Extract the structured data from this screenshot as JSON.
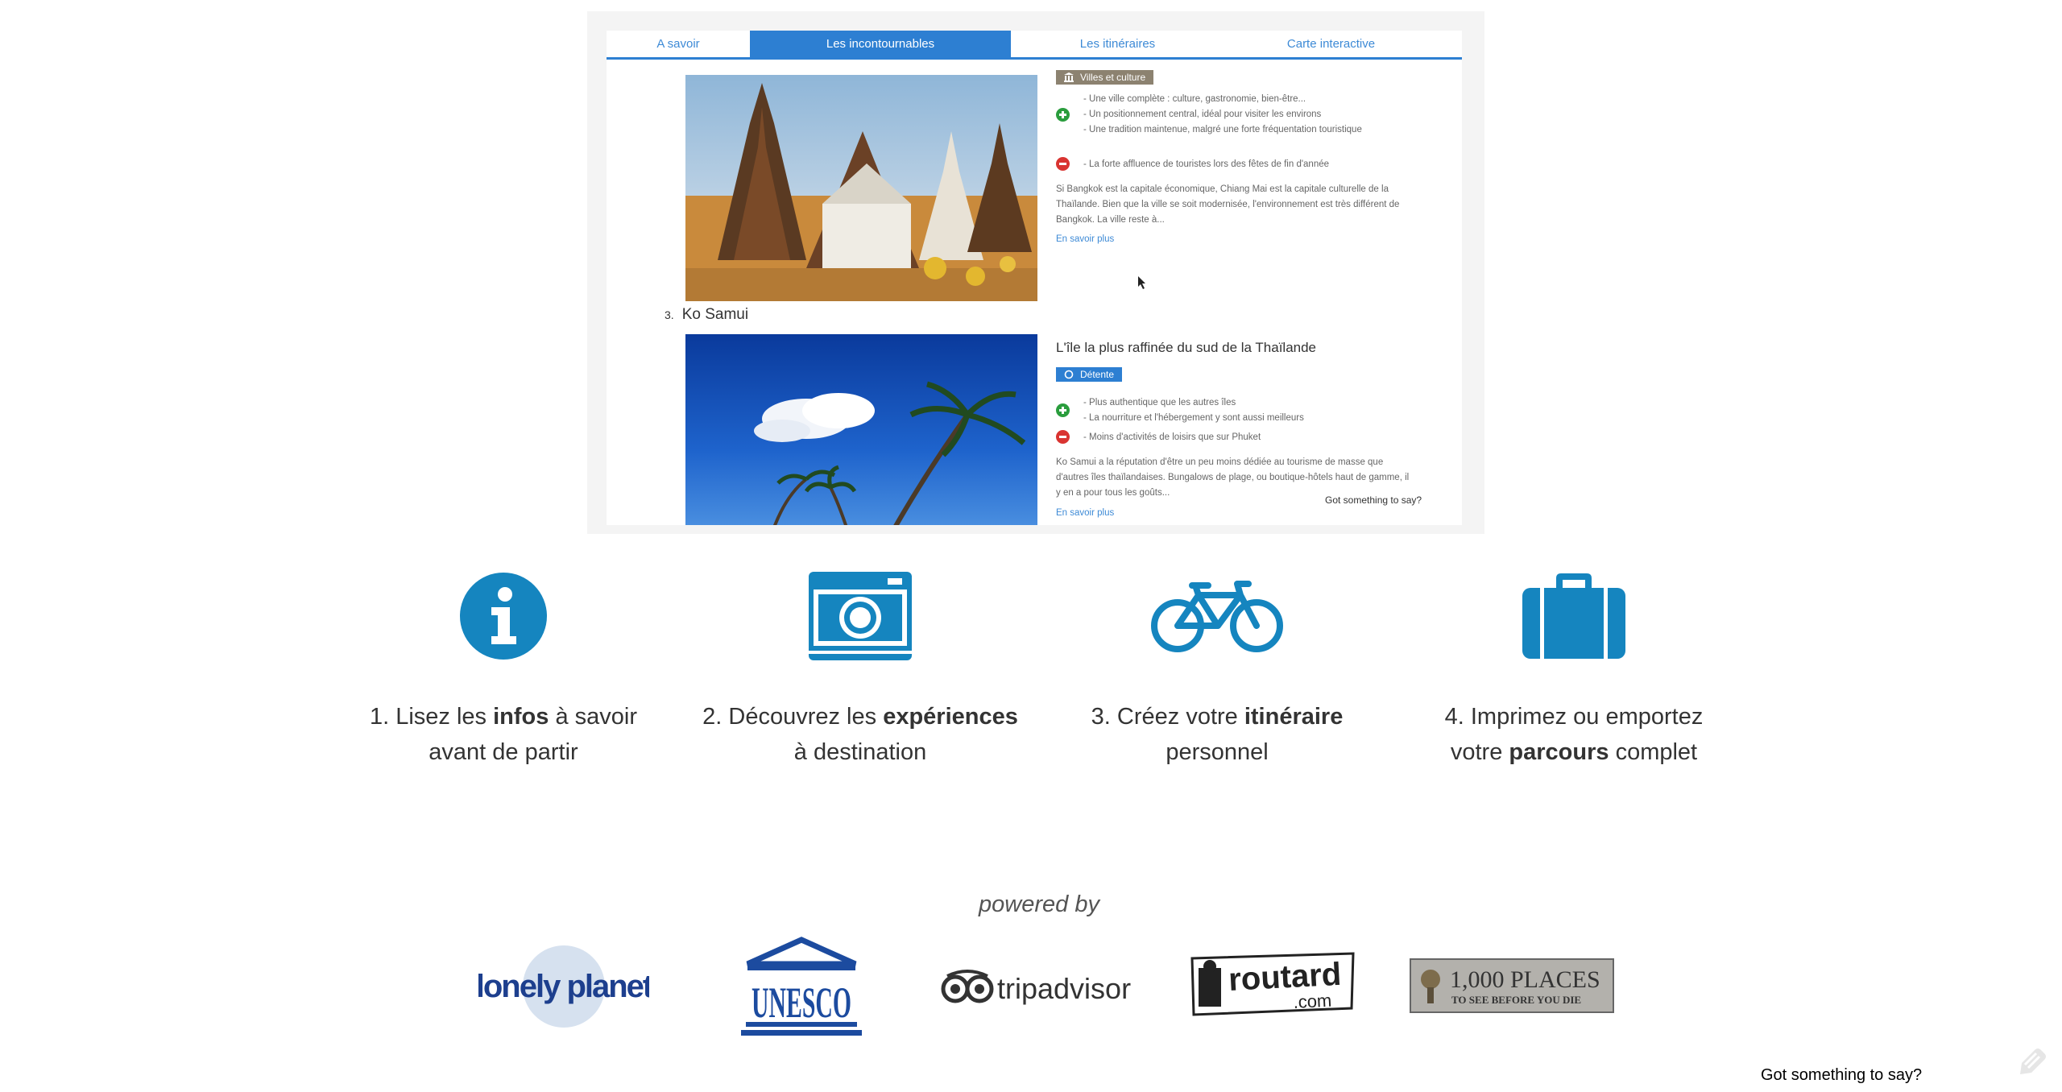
{
  "preview": {
    "tabs": [
      {
        "label": "A savoir",
        "active": false
      },
      {
        "label": "Les incontournables",
        "active": true
      },
      {
        "label": "Les itinéraires",
        "active": false
      },
      {
        "label": "Carte interactive",
        "active": false
      }
    ],
    "item2": {
      "tag": "Villes et culture",
      "pros": [
        "- Une ville complète : culture, gastronomie, bien-être...",
        "- Un positionnement central, idéal pour visiter les environs",
        "- Une tradition maintenue, malgré une forte fréquentation touristique"
      ],
      "cons": [
        "- La forte affluence de touristes lors des fêtes de fin d'année"
      ],
      "description": "Si Bangkok est la capitale économique, Chiang Mai est la capitale culturelle de la Thaïlande. Bien que la ville se soit modernisée, l'environnement est très différent de Bangkok. La ville reste à...",
      "more": "En savoir plus"
    },
    "item3": {
      "number": "3.",
      "name": "Ko Samui",
      "title": "L'île la plus raffinée du sud de la Thaïlande",
      "tag": "Détente",
      "pros": [
        "- Plus authentique que les autres îles",
        "- La nourriture et l'hébergement y sont aussi meilleurs"
      ],
      "cons": [
        "- Moins d'activités de loisirs que sur Phuket"
      ],
      "description": "Ko Samui a la réputation d'être un peu moins dédiée au tourisme de masse que d'autres îles thaïlandaises. Bungalows de plage, ou boutique-hôtels haut de gamme, il y en a pour tous les goûts...",
      "more": "En savoir plus"
    },
    "feedback": "Got something to say?"
  },
  "steps": [
    {
      "icon": "info-icon",
      "pre": "1. Lisez les ",
      "bold": "infos",
      "post": " à savoir",
      "line2": "avant de partir"
    },
    {
      "icon": "camera-icon",
      "pre": "2. Découvrez les ",
      "bold": "expériences",
      "post": "",
      "line2": "à destination"
    },
    {
      "icon": "bicycle-icon",
      "pre": "3. Créez votre ",
      "bold": "itinéraire",
      "post": "",
      "line2": "personnel"
    },
    {
      "icon": "suitcase-icon",
      "pre": "4. Imprimez ou emportez",
      "bold": "",
      "post": "",
      "line2_pre": "votre ",
      "line2_bold": "parcours",
      "line2_post": " complet"
    }
  ],
  "powered_by": "powered by",
  "logos": {
    "lonely_planet": "lonely planet",
    "unesco": "UNESCO",
    "tripadvisor": "tripadvisor",
    "routard": "routard",
    "routard_com": ".com",
    "thousand_places_1": "1,000 PLACES",
    "thousand_places_2": "TO SEE BEFORE YOU DIE"
  },
  "feedback": "Got something to say?",
  "colors": {
    "accent": "#1585bf",
    "tab_blue": "#2d7fd2"
  }
}
